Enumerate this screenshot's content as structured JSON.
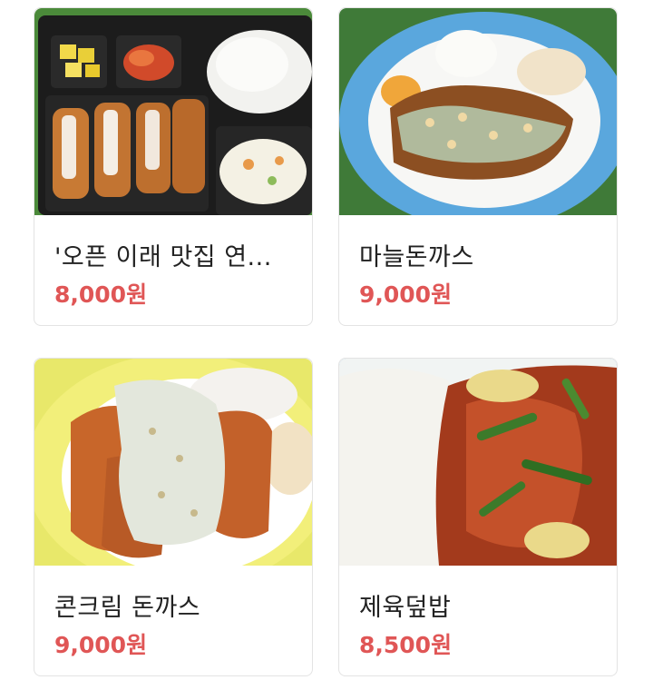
{
  "items": [
    {
      "name": "'오픈 이래 맛집 연...",
      "price": "8,000원",
      "image": "tonkatsu-lunchbox-photo"
    },
    {
      "name": "마늘돈까스",
      "price": "9,000원",
      "image": "garlic-tonkatsu-photo"
    },
    {
      "name": "콘크림 돈까스",
      "price": "9,000원",
      "image": "corn-cream-tonkatsu-photo"
    },
    {
      "name": "제육덮밥",
      "price": "8,500원",
      "image": "spicy-pork-rice-photo"
    }
  ],
  "colors": {
    "price": "#e05656",
    "card_border": "#e3e3e3"
  }
}
